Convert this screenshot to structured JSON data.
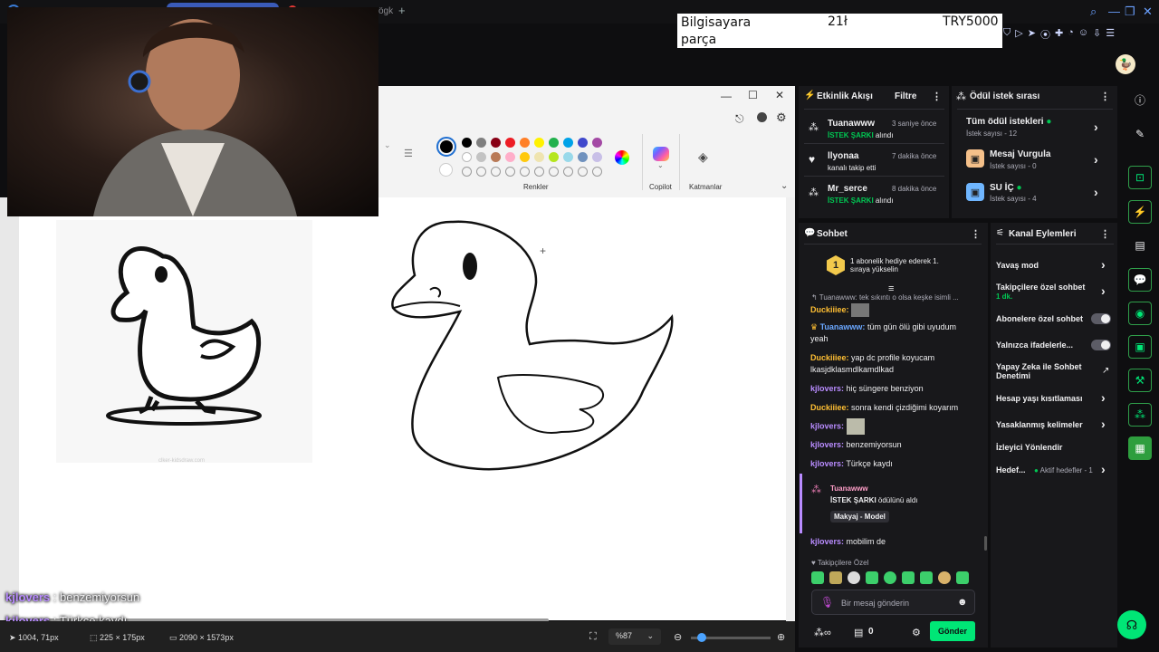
{
  "browser": {
    "tab_text": "ögk",
    "tab_plus": "+"
  },
  "banner": {
    "item": "Bilgisayara parça",
    "qty": "21ł",
    "price": "TRY5000"
  },
  "paint": {
    "colors_label": "Renkler",
    "copilot_label": "Copilot",
    "layers_label": "Katmanlar",
    "status": {
      "cursor": "1004, 71px",
      "selection": "225 × 175px",
      "size": "2090 × 1573px",
      "zoom": "%87"
    },
    "swatches_row1": [
      "#000000",
      "#7f7f7f",
      "#880015",
      "#ed1c24",
      "#ff7f27",
      "#fff200",
      "#22b14c",
      "#00a2e8",
      "#3f48cc",
      "#a349a4"
    ],
    "swatches_row2": [
      "#ffffff",
      "#c3c3c3",
      "#b97a57",
      "#ffaec9",
      "#ffc90e",
      "#efe4b0",
      "#b5e61d",
      "#99d9ea",
      "#7092be",
      "#c8bfe7"
    ],
    "watermark": "clker-kidsdraw.com"
  },
  "overlay_chat": [
    {
      "user": "kjlovers",
      "text": "benzemiyorsun"
    },
    {
      "user": "kjlovers",
      "text": "Türkçe kaydı"
    }
  ],
  "activity": {
    "title": "Etkinlik Akışı",
    "filter": "Filtre",
    "items": [
      {
        "user": "Tuanawww",
        "time": "3 saniye önce",
        "action_hl": "İSTEK ŞARKI",
        "action": "alındı"
      },
      {
        "user": "llyonaa",
        "time": "7 dakika önce",
        "action_hl": "",
        "action": "kanalı takip etti"
      },
      {
        "user": "Mr_serce",
        "time": "8 dakika önce",
        "action_hl": "İSTEK ŞARKI",
        "action": "alındı"
      }
    ]
  },
  "rewards": {
    "title": "Ödül istek sırası",
    "items": [
      {
        "name": "Tüm ödül istekleri",
        "sub": "İstek sayısı - 12"
      },
      {
        "name": "Mesaj Vurgula",
        "sub": "İstek sayısı - 0"
      },
      {
        "name": "SU İÇ",
        "sub": "İstek sayısı - 4"
      }
    ]
  },
  "chat": {
    "title": "Sohbet",
    "promo_num": "1",
    "promo": "1 abonelik hediye ederek 1. sıraya yükselin",
    "reply": "Tuanawww: tek sıkıntı o olsa keşke isimli ...",
    "messages": [
      {
        "user": "Duckiiiee:",
        "text": "",
        "cls": "nm-y"
      },
      {
        "user": "Tuanawww:",
        "text": "tüm gün ölü gibi uyudum yeah",
        "cls": "nm-b"
      },
      {
        "user": "Duckiiiee:",
        "text": "yap dc profile koyucam lkasjdklasmdlkamdlkad",
        "cls": "nm-y"
      },
      {
        "user": "kjlovers:",
        "text": "hiç süngere benziyon",
        "cls": "nm-p"
      },
      {
        "user": "Duckiiiee:",
        "text": "sonra kendi çizdiğimi koyarım",
        "cls": "nm-y"
      },
      {
        "user": "kjlovers:",
        "text": "",
        "cls": "nm-p"
      },
      {
        "user": "kjlovers:",
        "text": "benzemiyorsun",
        "cls": "nm-p"
      },
      {
        "user": "kjlovers:",
        "text": "Türkçe kaydı",
        "cls": "nm-p"
      }
    ],
    "redeem": {
      "user": "Tuanawww",
      "reward": "İSTEK ŞARKI",
      "rest": "ödülünü aldı",
      "tag": "Makyaj - Model"
    },
    "last": {
      "user": "kjlovers:",
      "text": "mobilim de"
    },
    "followers_label": "Takipçilere Özel",
    "input_placeholder": "Bir mesaj gönderin",
    "points": "0",
    "send": "Gönder"
  },
  "channel_actions": {
    "title": "Kanal Eylemleri",
    "items": [
      {
        "label": "Yavaş mod",
        "sub": "",
        "ctrl": "chev"
      },
      {
        "label": "Takipçilere özel sohbet",
        "sub": "1 dk.",
        "ctrl": "chev"
      },
      {
        "label": "Abonelere özel sohbet",
        "sub": "",
        "ctrl": "toggle"
      },
      {
        "label": "Yalnızca ifadelerle...",
        "sub": "",
        "ctrl": "toggle"
      },
      {
        "label": "Yapay Zeka ile Sohbet Denetimi",
        "sub": "",
        "ctrl": "ext"
      },
      {
        "label": "Hesap yaşı kısıtlaması",
        "sub": "",
        "ctrl": "chev"
      },
      {
        "label": "Yasaklanmış kelimeler",
        "sub": "",
        "ctrl": "chev"
      },
      {
        "label": "İzleyici Yönlendir",
        "sub": "",
        "ctrl": "none"
      },
      {
        "label": "Hedef...",
        "sub": "Aktif hedefler - 1",
        "ctrl": "chev"
      }
    ]
  }
}
